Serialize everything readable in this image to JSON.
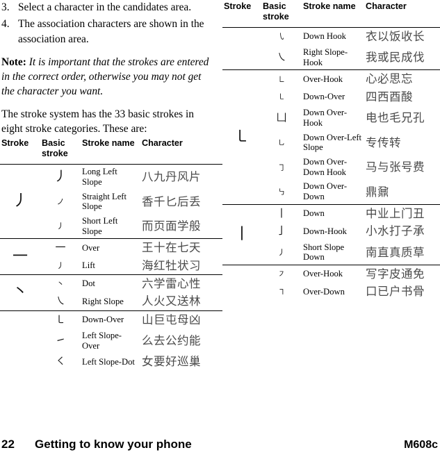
{
  "steps": [
    {
      "num": "3.",
      "text": "Select a character in the candidates area."
    },
    {
      "num": "4.",
      "text": "The association characters are shown in the association area."
    }
  ],
  "note": {
    "label": "Note:",
    "body": "It is important that the strokes are entered in the correct order, otherwise you may not get the character you want."
  },
  "intro": "The stroke system has the 33 basic strokes in eight stroke categories. These are:",
  "table_headers": {
    "stroke": "Stroke",
    "basic_stroke": "Basic stroke",
    "stroke_name": "Stroke name",
    "character": "Character"
  },
  "left_table": {
    "groups": [
      {
        "stroke": "丿",
        "rows": [
          {
            "basic": "丿",
            "size": "lg",
            "name": "Long Left Slope",
            "chars": "八九丹风片"
          },
          {
            "basic": "ノ",
            "size": "sm",
            "name": "Straight Left Slope",
            "chars": "香千匕后丢"
          },
          {
            "basic": "丿",
            "size": "sm",
            "name": "Short Left Slope",
            "chars": "而页面学般"
          }
        ]
      },
      {
        "stroke": "一",
        "rows": [
          {
            "basic": "一",
            "size": "",
            "name": "Over",
            "chars": "王十在七天"
          },
          {
            "basic": "丿",
            "size": "sm",
            "name": "Lift",
            "chars": "海红牡状习"
          }
        ]
      },
      {
        "stroke": "丶",
        "rows": [
          {
            "basic": "丶",
            "size": "sm",
            "name": "Dot",
            "chars": "六学雷心性"
          },
          {
            "basic": "㇏",
            "size": "",
            "name": "Right Slope",
            "chars": "人火又送林"
          }
        ]
      },
      {
        "stroke": "",
        "rows": [
          {
            "basic": "㇄",
            "size": "",
            "name": "Down-Over",
            "chars": "山巨屯母凶"
          },
          {
            "basic": "㇀",
            "size": "",
            "name": "Left Slope-Over",
            "chars": "么去公约能"
          },
          {
            "basic": "㇛",
            "size": "",
            "name": "Left Slope-Dot",
            "chars": "女要好巡巢"
          }
        ]
      }
    ]
  },
  "right_table": {
    "groups": [
      {
        "stroke": "",
        "rows": [
          {
            "basic": "㇂",
            "size": "sm",
            "name": "Down Hook",
            "chars": "衣以饭收长"
          },
          {
            "basic": "㇏",
            "size": "",
            "name": "Right Slope-Hook",
            "chars": "我或民成伐"
          }
        ]
      },
      {
        "stroke": "㇄",
        "rows": [
          {
            "basic": "㇗",
            "size": "sm",
            "name": "Over-Hook",
            "chars": "心必思忘"
          },
          {
            "basic": "㇄",
            "size": "sm",
            "name": "Down-Over",
            "chars": "四西酉酸"
          },
          {
            "basic": "凵",
            "size": "",
            "name": "Down Over-Hook",
            "chars": "电也毛兄孔"
          },
          {
            "basic": "㇟",
            "size": "sm",
            "name": "Down Over-Left Slope",
            "chars": "专传转"
          },
          {
            "basic": "㇆",
            "size": "sm",
            "name": "Down Over-Down Hook",
            "chars": "马与张号费"
          },
          {
            "basic": "㇉",
            "size": "sm",
            "name": "Down Over-Down",
            "chars": "鼎鼐"
          }
        ]
      },
      {
        "stroke": "丨",
        "rows": [
          {
            "basic": "丨",
            "size": "",
            "name": "Down",
            "chars": "中业上门丑"
          },
          {
            "basic": "亅",
            "size": "",
            "name": "Down-Hook",
            "chars": "小水打子承"
          },
          {
            "basic": "丿",
            "size": "sm",
            "name": "Short Slope Down",
            "chars": "南直真质草"
          }
        ]
      },
      {
        "stroke": "",
        "rows": [
          {
            "basic": "㇇",
            "size": "sm",
            "name": "Over-Hook",
            "chars": "写字皮通免"
          },
          {
            "basic": "㇕",
            "size": "sm",
            "name": "Over-Down",
            "chars": "口已户书骨"
          }
        ]
      }
    ]
  },
  "footer": {
    "page_number": "22",
    "title": "Getting to know your phone",
    "model": "M608c"
  }
}
